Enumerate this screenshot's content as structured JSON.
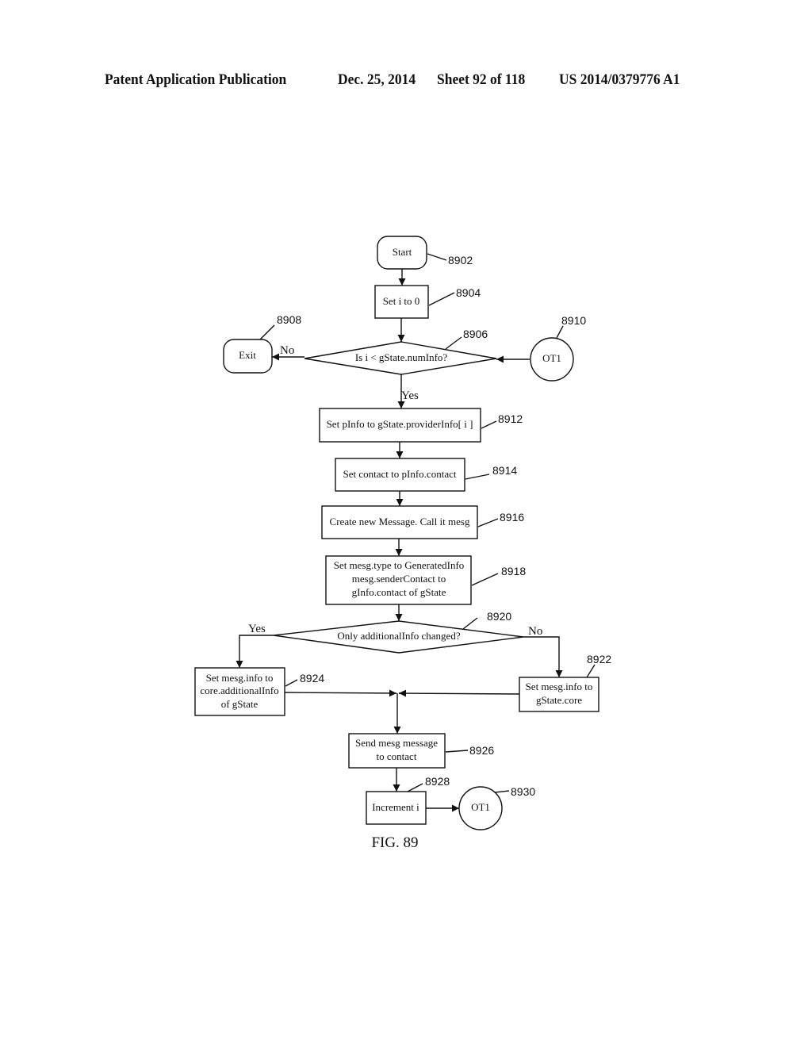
{
  "header": {
    "publication": "Patent Application Publication",
    "date": "Dec. 25, 2014",
    "sheet": "Sheet 92 of 118",
    "number": "US 2014/0379776 A1"
  },
  "diagram": {
    "figure_label": "FIG. 89",
    "nodes": {
      "start": {
        "text": "Start",
        "ref": "8902",
        "shape": "terminator"
      },
      "set_i": {
        "text": "Set i to 0",
        "ref": "8904",
        "shape": "process"
      },
      "decision_i": {
        "text": "Is i < gState.numInfo?",
        "ref": "8906",
        "shape": "decision"
      },
      "exit": {
        "text": "Exit",
        "ref": "8908",
        "shape": "terminator"
      },
      "ot1_in": {
        "text": "OT1",
        "ref": "8910",
        "shape": "connector"
      },
      "set_pinfo": {
        "text": "Set pInfo to gState.providerInfo[ i ]",
        "ref": "8912",
        "shape": "process"
      },
      "set_contact": {
        "text": "Set contact to pInfo.contact",
        "ref": "8914",
        "shape": "process"
      },
      "create_msg": {
        "text": "Create new Message. Call it mesg",
        "ref": "8916",
        "shape": "process"
      },
      "set_type": {
        "lines": [
          "Set mesg.type to GeneratedInfo",
          "mesg.senderContact to",
          "gInfo.contact of gState"
        ],
        "ref": "8918",
        "shape": "process"
      },
      "decision_add": {
        "text": "Only additionalInfo changed?",
        "ref": "8920",
        "shape": "decision"
      },
      "set_core": {
        "lines": [
          "Set mesg.info to",
          "gState.core"
        ],
        "ref": "8922",
        "shape": "process"
      },
      "set_additional": {
        "lines": [
          "Set mesg.info to",
          "core.additionalInfo",
          "of gState"
        ],
        "ref": "8924",
        "shape": "process"
      },
      "send_msg": {
        "lines": [
          "Send mesg message",
          "to contact"
        ],
        "ref": "8926",
        "shape": "process"
      },
      "increment": {
        "text": "Increment i",
        "ref": "8928",
        "shape": "process"
      },
      "ot1_out": {
        "text": "OT1",
        "ref": "8930",
        "shape": "connector"
      }
    },
    "edge_labels": {
      "decision_i_no": "No",
      "decision_i_yes": "Yes",
      "decision_add_yes": "Yes",
      "decision_add_no": "No"
    }
  }
}
